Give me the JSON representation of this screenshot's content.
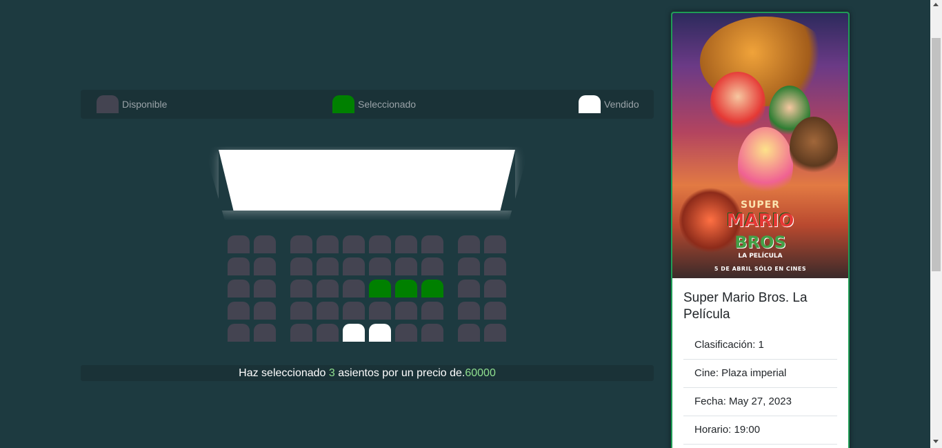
{
  "legend": {
    "available_label": "Disponible",
    "selected_label": "Seleccionado",
    "sold_label": "Vendido",
    "available_color": "#444451",
    "selected_color": "#008000",
    "sold_color": "#ffffff"
  },
  "seat_map": {
    "rows": [
      [
        "available",
        "available",
        "available",
        "available",
        "available",
        "available",
        "available",
        "available",
        "available",
        "available"
      ],
      [
        "available",
        "available",
        "available",
        "available",
        "available",
        "available",
        "available",
        "available",
        "available",
        "available"
      ],
      [
        "available",
        "available",
        "available",
        "available",
        "available",
        "selected",
        "selected",
        "selected",
        "available",
        "available"
      ],
      [
        "available",
        "available",
        "available",
        "available",
        "available",
        "available",
        "available",
        "available",
        "available",
        "available"
      ],
      [
        "available",
        "available",
        "available",
        "available",
        "sold",
        "sold",
        "available",
        "available",
        "available",
        "available"
      ]
    ]
  },
  "summary": {
    "prefix": "Haz seleccionado ",
    "count": "3",
    "middle": " asientos por un precio de.",
    "price": "60000"
  },
  "movie": {
    "poster_lines": [
      "SUPER",
      "MARIO",
      "BROS",
      "LA PELÍCULA",
      "5 DE ABRIL SÓLO EN CINES"
    ],
    "title": "Super Mario Bros. La Película",
    "info": [
      "Clasificación: 1",
      "Cine: Plaza imperial",
      "Fecha: May 27, 2023",
      "Horario: 19:00"
    ]
  }
}
